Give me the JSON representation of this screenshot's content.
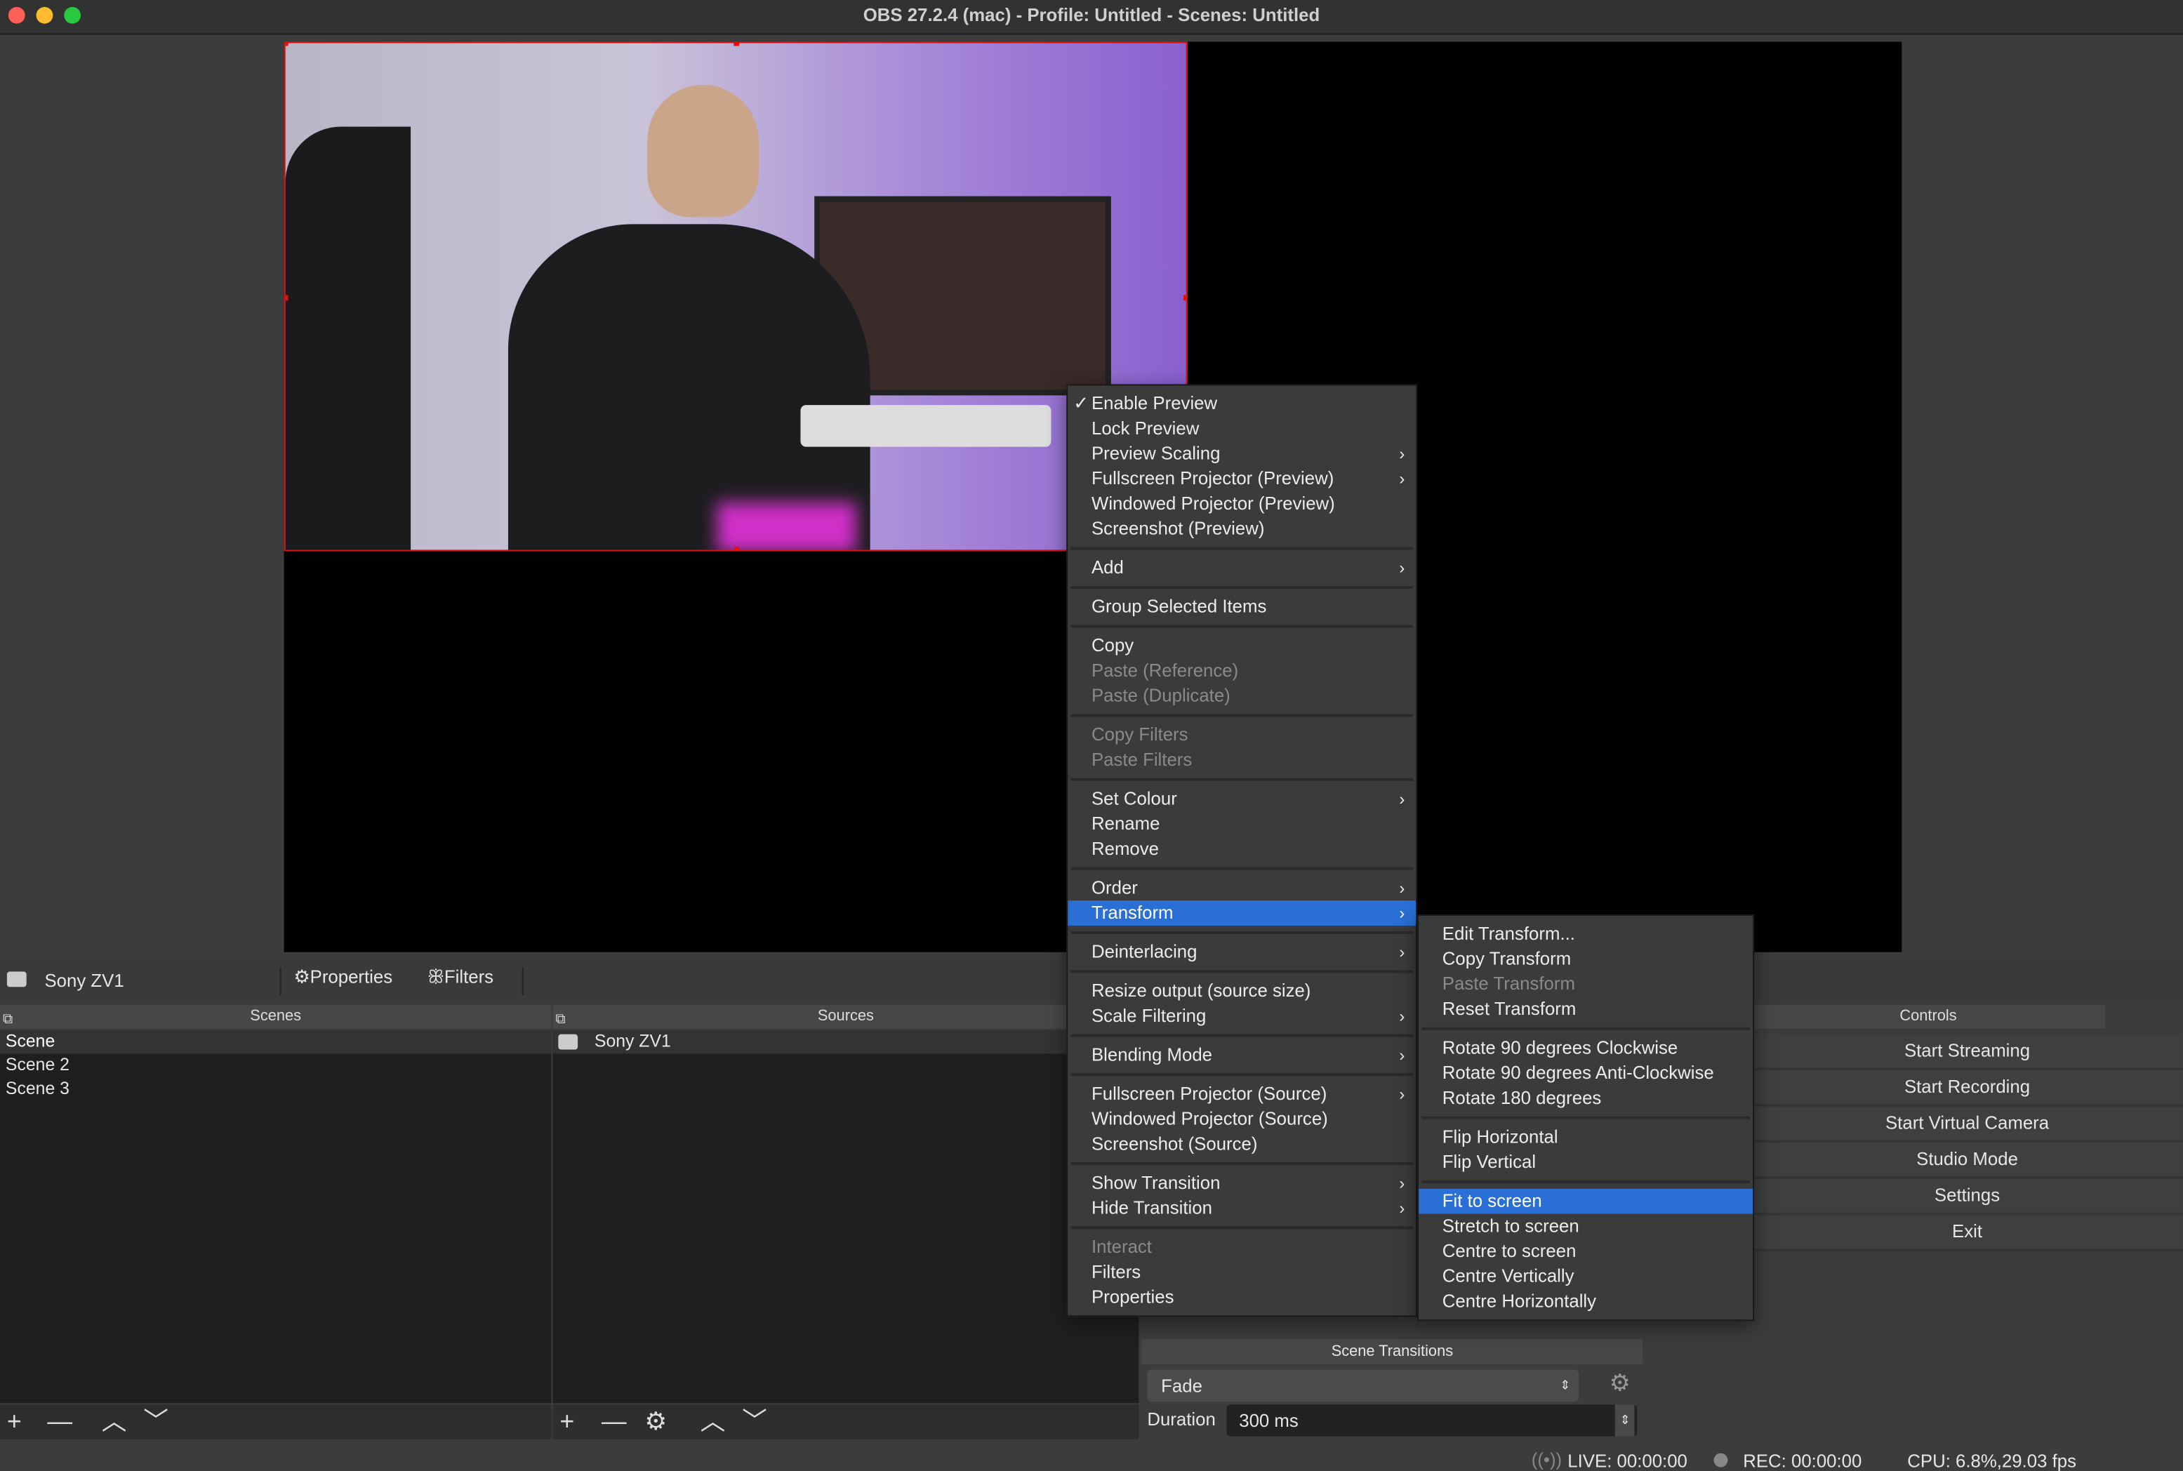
{
  "window": {
    "title": "OBS 27.2.4 (mac) - Profile: Untitled - Scenes: Untitled"
  },
  "colors": {
    "accent": "#2a6fd6",
    "selection_border": "#e01010"
  },
  "source_toolbar": {
    "source_name": "Sony ZV1",
    "properties": "Properties",
    "filters": "Filters"
  },
  "scenes": {
    "title": "Scenes",
    "items": [
      "Scene",
      "Scene 2",
      "Scene 3"
    ],
    "selected": "Scene"
  },
  "sources": {
    "title": "Sources",
    "items": [
      "Sony ZV1"
    ]
  },
  "controls": {
    "title": "Controls",
    "buttons": [
      "Start Streaming",
      "Start Recording",
      "Start Virtual Camera",
      "Studio Mode",
      "Settings",
      "Exit"
    ]
  },
  "transitions": {
    "title": "Scene Transitions",
    "selected": "Fade",
    "duration_label": "Duration",
    "duration": "300 ms"
  },
  "status": {
    "live": "LIVE: 00:00:00",
    "rec": "REC: 00:00:00",
    "cpu": "CPU: 6.8%,29.03 fps"
  },
  "context_menu": {
    "sections": [
      [
        {
          "label": "Enable Preview",
          "checked": true
        },
        {
          "label": "Lock Preview"
        },
        {
          "label": "Preview Scaling",
          "sub": true
        },
        {
          "label": "Fullscreen Projector (Preview)",
          "sub": true
        },
        {
          "label": "Windowed Projector (Preview)"
        },
        {
          "label": "Screenshot (Preview)"
        }
      ],
      [
        {
          "label": "Add",
          "sub": true
        }
      ],
      [
        {
          "label": "Group Selected Items"
        }
      ],
      [
        {
          "label": "Copy"
        },
        {
          "label": "Paste (Reference)",
          "disabled": true
        },
        {
          "label": "Paste (Duplicate)",
          "disabled": true
        }
      ],
      [
        {
          "label": "Copy Filters",
          "disabled": true
        },
        {
          "label": "Paste Filters",
          "disabled": true
        }
      ],
      [
        {
          "label": "Set Colour",
          "sub": true
        },
        {
          "label": "Rename"
        },
        {
          "label": "Remove"
        }
      ],
      [
        {
          "label": "Order",
          "sub": true
        },
        {
          "label": "Transform",
          "sub": true,
          "highlighted": true
        }
      ],
      [
        {
          "label": "Deinterlacing",
          "sub": true
        }
      ],
      [
        {
          "label": "Resize output (source size)"
        },
        {
          "label": "Scale Filtering",
          "sub": true
        }
      ],
      [
        {
          "label": "Blending Mode",
          "sub": true
        }
      ],
      [
        {
          "label": "Fullscreen Projector (Source)",
          "sub": true
        },
        {
          "label": "Windowed Projector (Source)"
        },
        {
          "label": "Screenshot (Source)"
        }
      ],
      [
        {
          "label": "Show Transition",
          "sub": true
        },
        {
          "label": "Hide Transition",
          "sub": true
        }
      ],
      [
        {
          "label": "Interact",
          "disabled": true
        },
        {
          "label": "Filters"
        },
        {
          "label": "Properties"
        }
      ]
    ]
  },
  "transform_submenu": {
    "sections": [
      [
        {
          "label": "Edit Transform..."
        },
        {
          "label": "Copy Transform"
        },
        {
          "label": "Paste Transform",
          "disabled": true
        },
        {
          "label": "Reset Transform"
        }
      ],
      [
        {
          "label": "Rotate 90 degrees Clockwise"
        },
        {
          "label": "Rotate 90 degrees Anti-Clockwise"
        },
        {
          "label": "Rotate 180 degrees"
        }
      ],
      [
        {
          "label": "Flip Horizontal"
        },
        {
          "label": "Flip Vertical"
        }
      ],
      [
        {
          "label": "Fit to screen",
          "highlighted": true
        },
        {
          "label": "Stretch to screen"
        },
        {
          "label": "Centre to screen"
        },
        {
          "label": "Centre Vertically"
        },
        {
          "label": "Centre Horizontally"
        }
      ]
    ]
  }
}
